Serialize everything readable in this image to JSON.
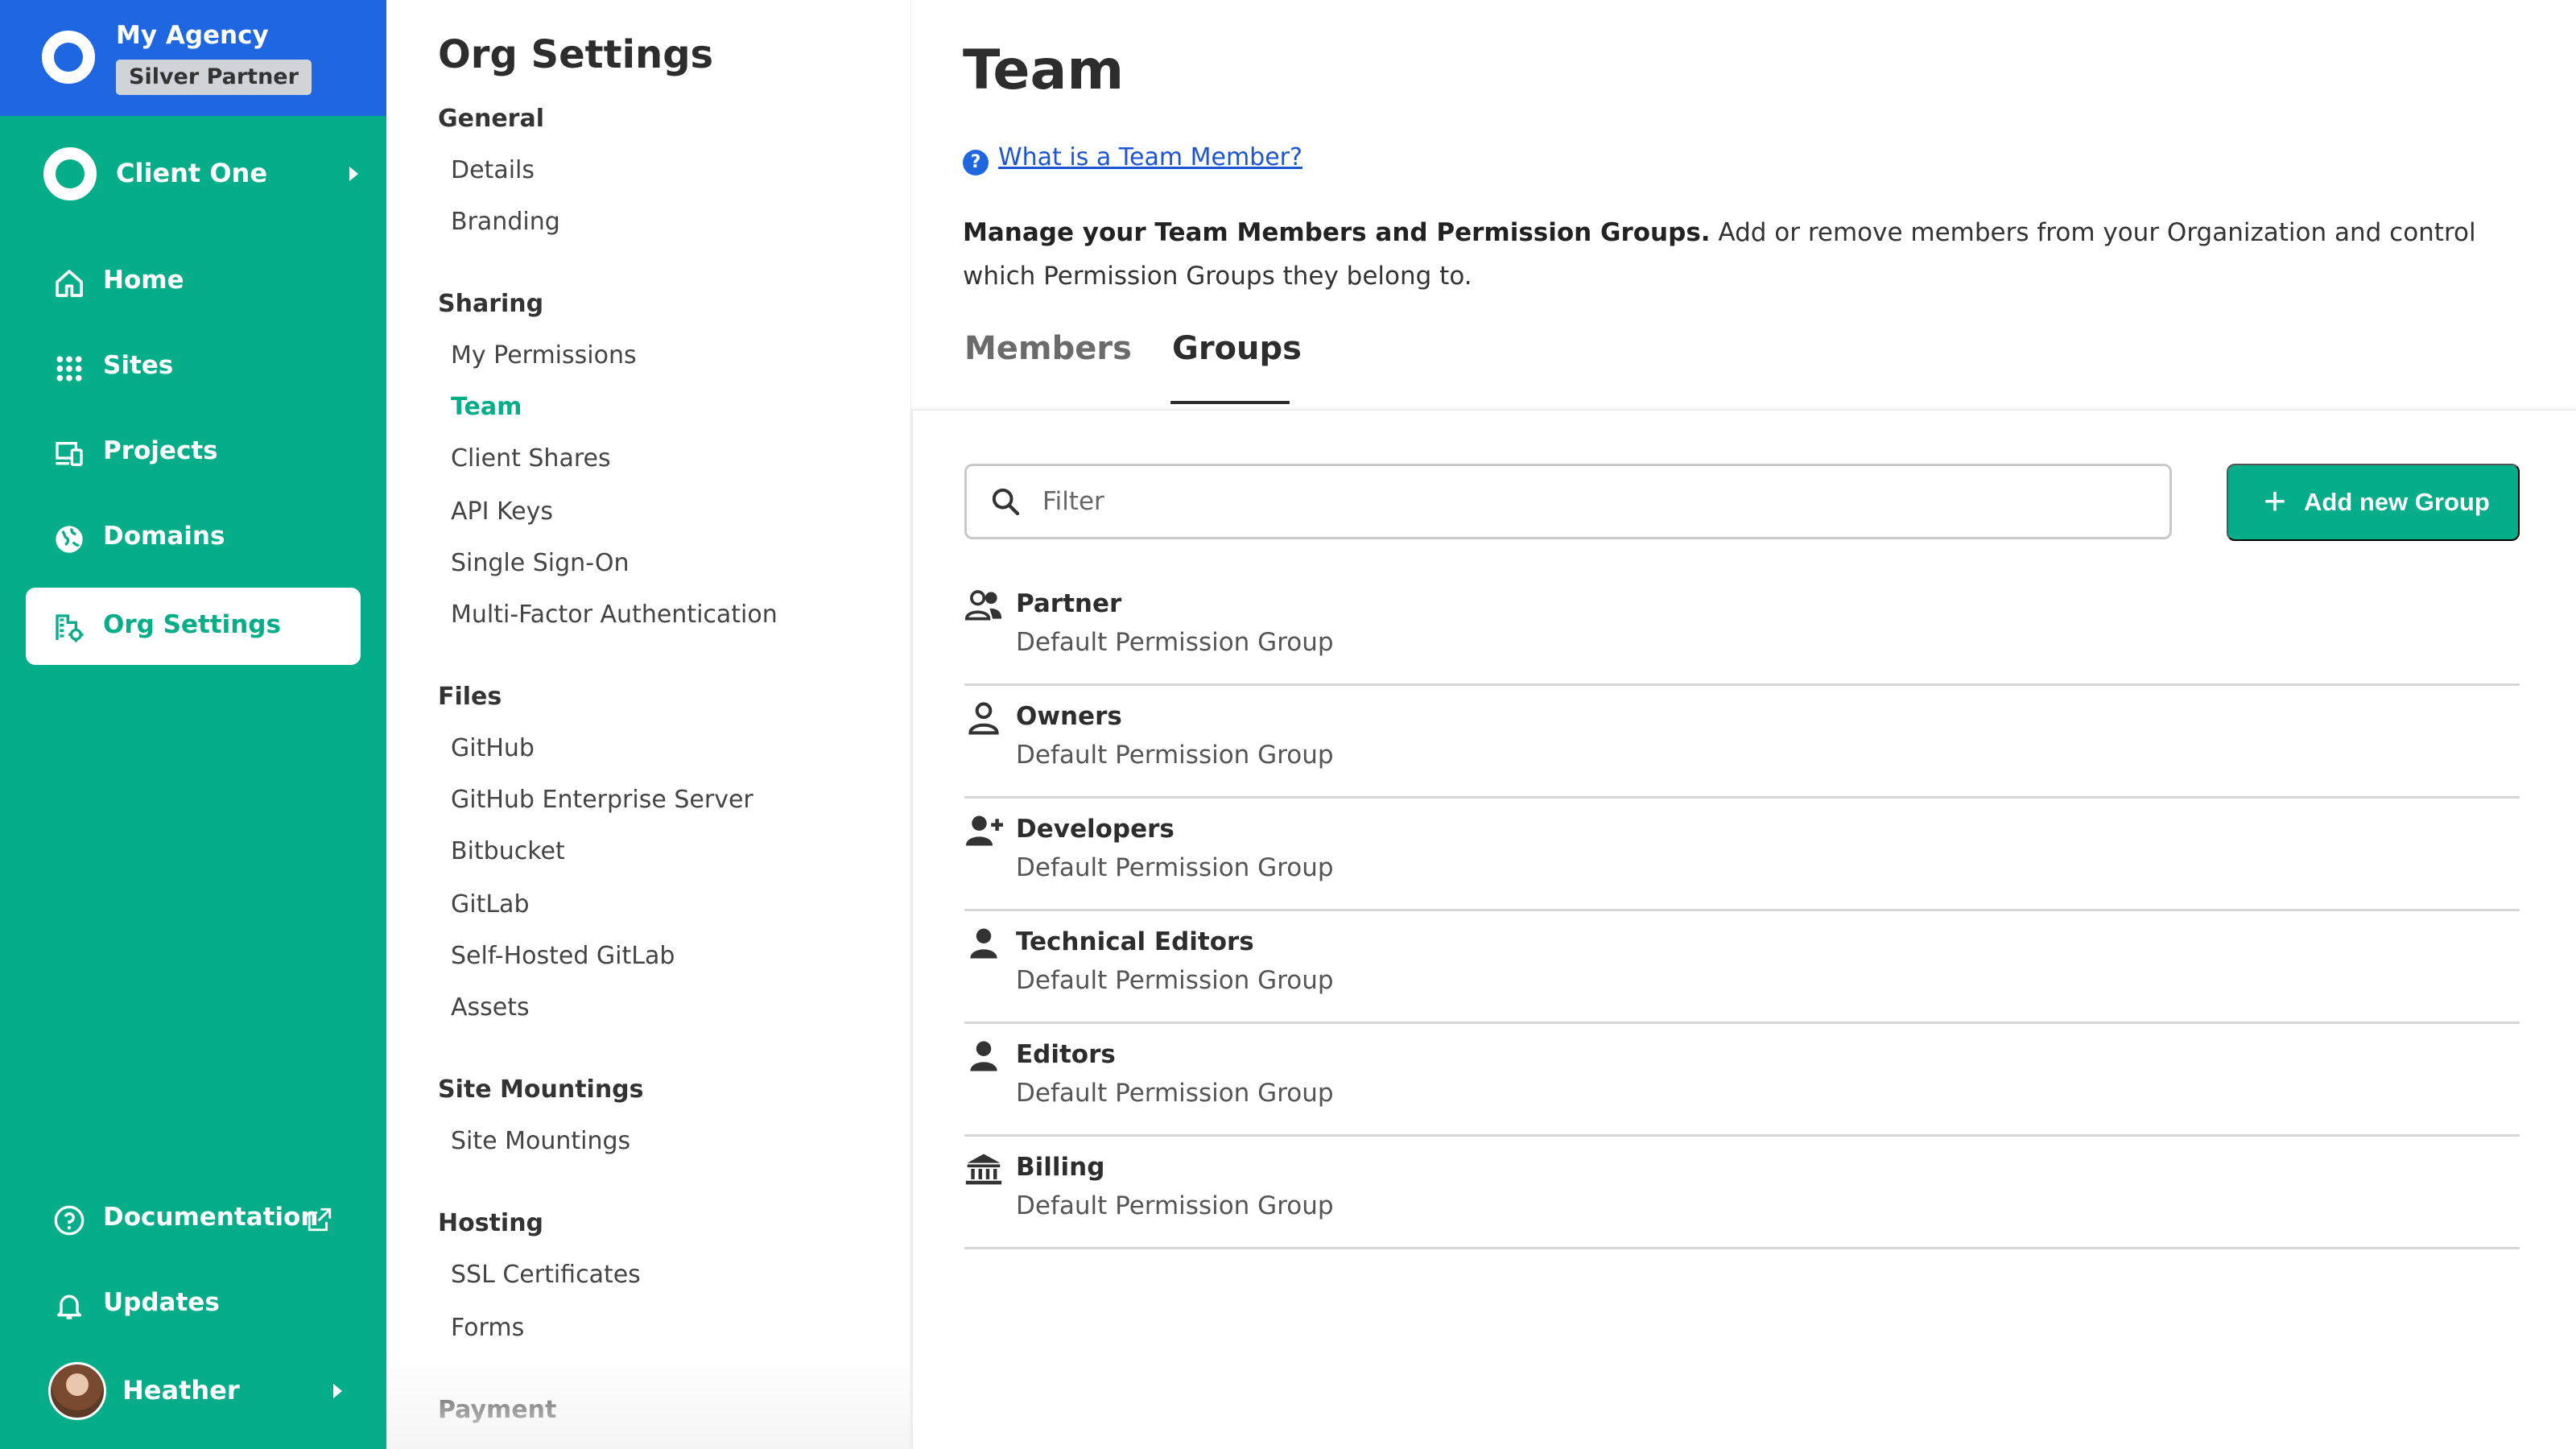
{
  "agency": {
    "name": "My Agency",
    "badge": "Silver Partner"
  },
  "client": {
    "name": "Client One"
  },
  "nav": {
    "items": [
      {
        "label": "Home",
        "icon": "home-icon"
      },
      {
        "label": "Sites",
        "icon": "grid-icon"
      },
      {
        "label": "Projects",
        "icon": "devices-icon"
      },
      {
        "label": "Domains",
        "icon": "globe-icon"
      },
      {
        "label": "Org Settings",
        "icon": "org-settings-icon",
        "active": true
      }
    ],
    "documentation": "Documentation",
    "updates": "Updates"
  },
  "user": {
    "name": "Heather"
  },
  "settings": {
    "title": "Org Settings",
    "sections": [
      {
        "title": "General",
        "items": [
          "Details",
          "Branding"
        ]
      },
      {
        "title": "Sharing",
        "items": [
          "My Permissions",
          "Team",
          "Client Shares",
          "API Keys",
          "Single Sign-On",
          "Multi-Factor Authentication"
        ]
      },
      {
        "title": "Files",
        "items": [
          "GitHub",
          "GitHub Enterprise Server",
          "Bitbucket",
          "GitLab",
          "Self-Hosted GitLab",
          "Assets"
        ]
      },
      {
        "title": "Site Mountings",
        "items": [
          "Site Mountings"
        ]
      },
      {
        "title": "Hosting",
        "items": [
          "SSL Certificates",
          "Forms"
        ]
      },
      {
        "title": "Payment",
        "items": []
      }
    ],
    "active_item": "Team"
  },
  "main": {
    "title": "Team",
    "help_icon": "?",
    "help_link": "What is a Team Member?",
    "description_bold": "Manage your Team Members and Permission Groups.",
    "description_rest": " Add or remove members from your Organization and control which Permission Groups they belong to.",
    "tabs": [
      {
        "label": "Members",
        "active": false
      },
      {
        "label": "Groups",
        "active": true
      }
    ],
    "filter_placeholder": "Filter",
    "add_button": "Add new Group",
    "add_button_plus": "+",
    "groups": [
      {
        "name": "Partner",
        "desc": "Default Permission Group",
        "icon": "people-icon"
      },
      {
        "name": "Owners",
        "desc": "Default Permission Group",
        "icon": "person-outline-icon"
      },
      {
        "name": "Developers",
        "desc": "Default Permission Group",
        "icon": "person-add-icon"
      },
      {
        "name": "Technical Editors",
        "desc": "Default Permission Group",
        "icon": "person-icon"
      },
      {
        "name": "Editors",
        "desc": "Default Permission Group",
        "icon": "person-icon"
      },
      {
        "name": "Billing",
        "desc": "Default Permission Group",
        "icon": "bank-icon"
      }
    ]
  },
  "colors": {
    "green": "#05ad88",
    "blue": "#1e67e0",
    "link": "#1e55d1",
    "text": "#2d2d2d"
  }
}
